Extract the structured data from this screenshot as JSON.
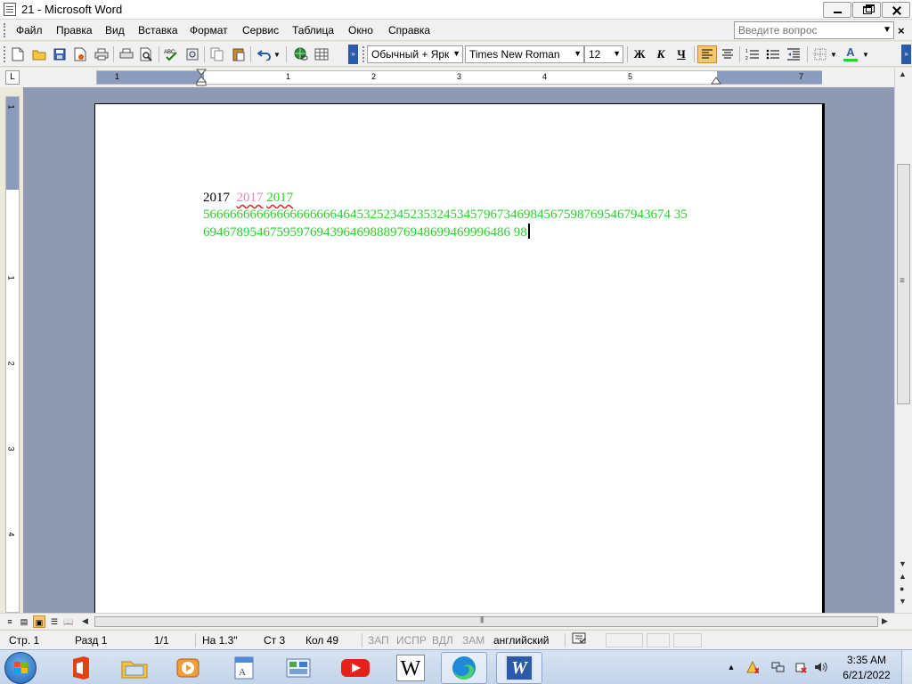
{
  "window": {
    "title": "21 - Microsoft Word"
  },
  "menu": {
    "items": [
      "Файл",
      "Правка",
      "Вид",
      "Вставка",
      "Формат",
      "Сервис",
      "Таблица",
      "Окно",
      "Справка"
    ],
    "ask_placeholder": "Введите вопрос"
  },
  "toolbar": {
    "style": "Обычный + Ярк",
    "font": "Times New Roman",
    "size": "12",
    "bold_label": "Ж",
    "italic_label": "К",
    "underline_label": "Ч",
    "font_color_label": "A",
    "font_color": "#2ad12a",
    "highlight_color": "#ffff00"
  },
  "ruler": {
    "h_numbers": [
      "1",
      "1",
      "2",
      "3",
      "4",
      "5",
      "7"
    ],
    "v_numbers": [
      "1",
      "1",
      "2",
      "3",
      "4"
    ]
  },
  "document": {
    "line1_a": "2017",
    "line1_b": "2017",
    "line1_c": "2017",
    "line2": "5666666666666666666646453252345235324534579673469845675987695467943674 35",
    "line3": "6946789546759597694396469888976948699469996486 98"
  },
  "status": {
    "page": "Стр. 1",
    "section": "Разд 1",
    "pages": "1/1",
    "at": "На 1.3\"",
    "line": "Ст 3",
    "col": "Кол 49",
    "rec": "ЗАП",
    "trk": "ИСПР",
    "ext": "ВДЛ",
    "ovr": "ЗАМ",
    "language": "английский"
  },
  "taskbar": {
    "apps": [
      "start-button",
      "office-icon",
      "explorer-icon",
      "media-player-icon",
      "wordpad-icon",
      "control-panel-icon",
      "youtube-icon",
      "wikipedia-icon",
      "edge-icon",
      "word-icon"
    ],
    "wiki_label": "W",
    "word_label": "W",
    "time": "3:35 AM",
    "date": "6/21/2022"
  }
}
